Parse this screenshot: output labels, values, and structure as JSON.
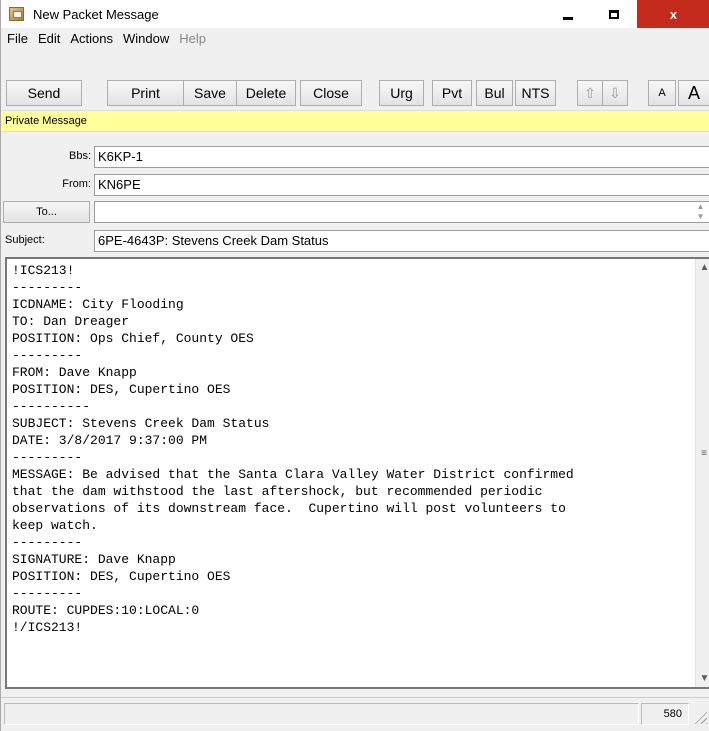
{
  "window": {
    "title": "New Packet Message",
    "close_glyph": "x"
  },
  "menu": [
    "File",
    "Edit",
    "Actions",
    "Window",
    "Help"
  ],
  "toolbar": {
    "send": "Send",
    "print": "Print",
    "save": "Save",
    "delete": "Delete",
    "close": "Close",
    "urg": "Urg",
    "pvt": "Pvt",
    "bul": "Bul",
    "nts": "NTS",
    "up_arrow": "⇧",
    "down_arrow": "⇩",
    "font_small": "A",
    "font_large": "A"
  },
  "message_type": "Private Message",
  "header": {
    "bbs_label": "Bbs:",
    "bbs_value": "K6KP-1",
    "from_label": "From:",
    "from_value": "KN6PE",
    "to_button": "To...",
    "to_value": "",
    "subject_label": "Subject:",
    "subject_value": "6PE-4643P: Stevens Creek Dam Status"
  },
  "body_lines": [
    "!ICS213!",
    "---------",
    "ICDNAME: City Flooding",
    "TO: Dan Dreager",
    "POSITION: Ops Chief, County OES",
    "---------",
    "FROM: Dave Knapp",
    "POSITION: DES, Cupertino OES",
    "----------",
    "SUBJECT: Stevens Creek Dam Status",
    "DATE: 3/8/2017 9:37:00 PM",
    "---------",
    "MESSAGE: Be advised that the Santa Clara Valley Water District confirmed",
    "that the dam withstood the last aftershock, but recommended periodic",
    "observations of its downstream face.  Cupertino will post volunteers to",
    "keep watch.",
    "---------",
    "SIGNATURE: Dave Knapp",
    "POSITION: DES, Cupertino OES",
    "---------",
    "ROUTE: CUPDES:10:LOCAL:0",
    "!/ICS213!"
  ],
  "status": {
    "char_count": "580"
  }
}
